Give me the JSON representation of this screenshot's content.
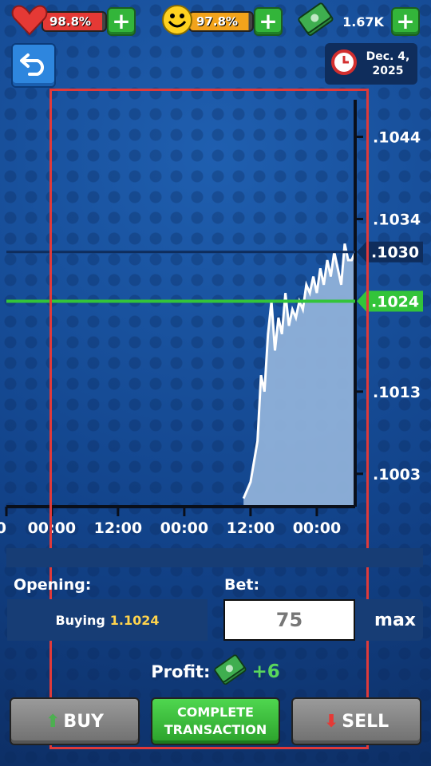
{
  "top_bar": {
    "health": {
      "value": "98.8%",
      "icon": "heart-icon",
      "color": "#e53935"
    },
    "happiness": {
      "value": "97.8%",
      "icon": "smiley-icon",
      "color": "#f2a31b"
    },
    "money": {
      "value": "1.67K",
      "icon": "cash-icon"
    }
  },
  "date": {
    "line1": "Dec. 4,",
    "line2": "2025",
    "icon": "clock-icon"
  },
  "chart_data": {
    "type": "area",
    "x_ticks": [
      "0",
      "00:00",
      "12:00",
      "00:00",
      "12:00",
      "00:00"
    ],
    "y_ticks": [
      ".1044",
      ".1034",
      ".1013",
      ".1003"
    ],
    "markers": [
      {
        "label": ".1030",
        "value": 1.103,
        "color": "#0f2d5c",
        "meaning": "current-price"
      },
      {
        "label": ".1024",
        "value": 1.1024,
        "color": "#33c43a",
        "meaning": "opening-price"
      }
    ],
    "ylim": [
      1.0999,
      1.1049
    ],
    "series": [
      {
        "x": [
          0.68,
          0.7,
          0.72,
          0.73,
          0.74,
          0.75,
          0.76,
          0.77,
          0.78,
          0.79,
          0.8,
          0.81,
          0.82,
          0.83,
          0.84,
          0.85,
          0.86,
          0.87,
          0.88,
          0.89,
          0.9,
          0.91,
          0.92,
          0.93,
          0.94,
          0.95,
          0.96,
          0.97,
          0.98,
          0.99,
          1.0
        ],
        "y": [
          1.1,
          1.1002,
          1.1007,
          1.1015,
          1.1013,
          1.102,
          1.1024,
          1.1018,
          1.1022,
          1.102,
          1.1025,
          1.1021,
          1.1023,
          1.1022,
          1.1024,
          1.1023,
          1.1026,
          1.1025,
          1.1027,
          1.1025,
          1.1028,
          1.1026,
          1.1029,
          1.1027,
          1.103,
          1.1028,
          1.1026,
          1.1031,
          1.1029,
          1.1029,
          1.103
        ]
      }
    ],
    "area_color": "#8fb1d9",
    "line_color": "#ffffff"
  },
  "trade": {
    "opening_label": "Opening:",
    "opening_action": "Buying",
    "opening_price": "1.1024",
    "bet_label": "Bet:",
    "bet_value": "75",
    "max_label": "max"
  },
  "profit": {
    "label": "Profit:",
    "value": "+6",
    "icon": "cash-icon"
  },
  "buttons": {
    "buy": "BUY",
    "complete_line1": "COMPLETE",
    "complete_line2": "TRANSACTION",
    "sell": "SELL"
  }
}
